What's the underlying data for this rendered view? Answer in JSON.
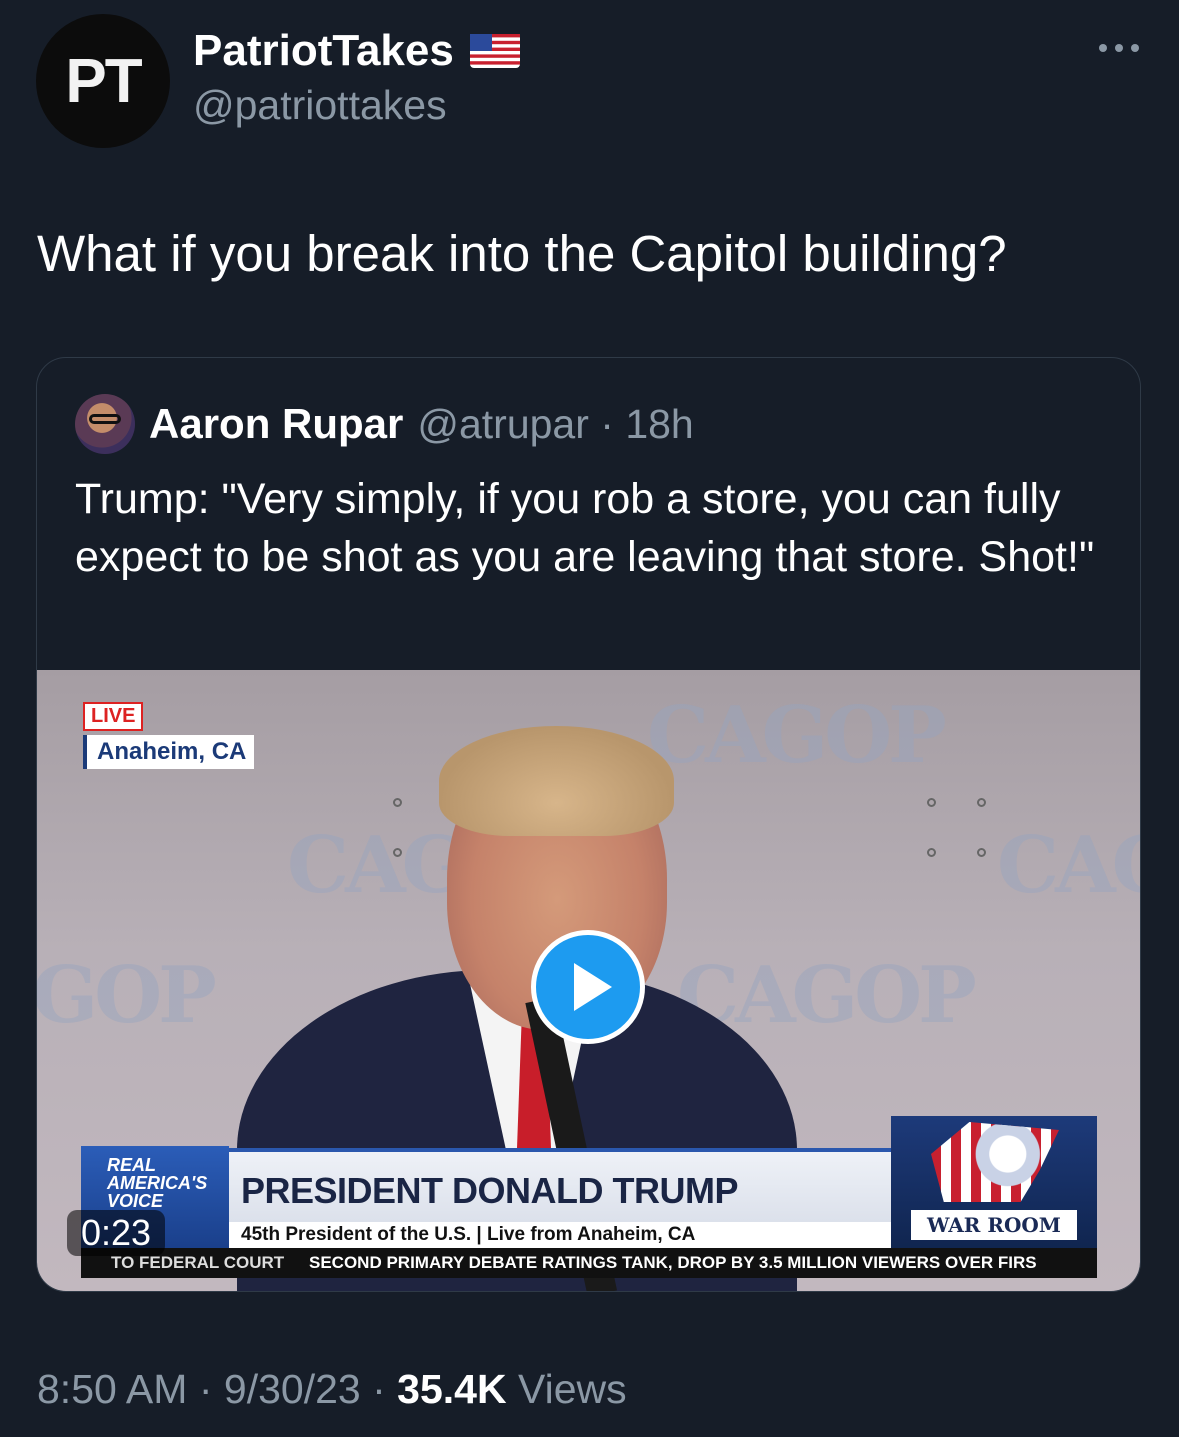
{
  "tweet": {
    "avatar_text": "PT",
    "display_name": "PatriotTakes",
    "handle": "@patriottakes",
    "text": "What if you break into the Capitol building?",
    "more_icon": "more-horizontal-icon"
  },
  "quoted": {
    "display_name": "Aaron Rupar",
    "handle_time": "@atrupar · 18h",
    "text": "Trump: \"Very simply, if you rob a store, you can fully expect to be shot as you are leaving that store. Shot!\"",
    "video": {
      "live_label": "LIVE",
      "location": "Anaheim, CA",
      "network": "REAL AMERICA'S VOICE",
      "nameplate_title": "PRESIDENT DONALD TRUMP",
      "nameplate_subtitle": "45th President of the U.S. | Live from Anaheim, CA",
      "show_logo": "WAR ROOM",
      "ticker_left": "TO FEDERAL COURT",
      "ticker_right": "SECOND PRIMARY DEBATE RATINGS TANK, DROP BY 3.5 MILLION VIEWERS OVER FIRS",
      "duration": "0:23",
      "background_logo": "CAGOP",
      "play_icon": "play-icon"
    }
  },
  "footer": {
    "time": "8:50 AM",
    "date": "9/30/23",
    "views_count": "35.4K",
    "views_label": "Views"
  },
  "colors": {
    "background": "#161d28",
    "secondary_text": "#8b98a5",
    "accent": "#1d9bf0"
  }
}
